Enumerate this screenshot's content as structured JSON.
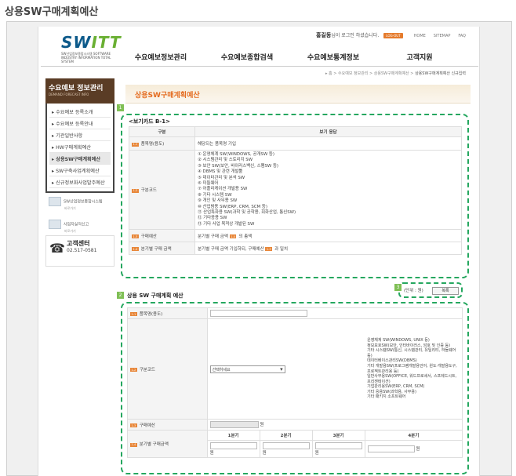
{
  "page_title": "상용SW구매계획예산",
  "header": {
    "logo_main": "SW",
    "logo_accent": "ITT",
    "logo_sub": "SW산업정보종합시스템 SOFTWARE INDUSTRY INFORMATION TOTAL SYSTEM",
    "user_name": "홍길동",
    "greeting": "님이 로그인 하셨습니다.",
    "logout": "LOG-OUT",
    "top_links": [
      "HOME",
      "SITEMAP",
      "FAQ"
    ],
    "gnb": [
      "수요예보정보관리",
      "수요예보종합검색",
      "수요예보통계정보",
      "고객지원"
    ]
  },
  "breadcrumb": {
    "path": "▸ 홈 > 수요예보 정보관리 > 상용SW구매계획예산 > ",
    "current": "상용SW구매계획예산 신규입력"
  },
  "lnb": {
    "title": "수요예보 정보관리",
    "subtitle": "DEMAND FORECAST INFO",
    "items": [
      "수요예보 등록소개",
      "수요예보 등록안내",
      "기관일반사항",
      "HW구매계획예산",
      "상용SW구매계획예산",
      "SW구축사업계획예산",
      "신규정보화사업발주예산"
    ],
    "active_index": 4,
    "links": [
      {
        "label": "SW산업정보종합시스템",
        "sub": "바로가기"
      },
      {
        "label": "사업자실적신고",
        "sub": "바로가기"
      }
    ],
    "call": {
      "label": "고객센터",
      "number": "02.517-0581"
    }
  },
  "content": {
    "title": "상용SW구매계획예산",
    "section1": {
      "badge": "1",
      "caption": "<보기카드 B-1>",
      "headers": [
        "구분",
        "보기 응답"
      ],
      "rows": [
        {
          "tag": "1-1",
          "label": "품목명(용도)",
          "value": "해당되는 품목명 기입"
        },
        {
          "tag": "1-2",
          "label": "구분코드",
          "options": [
            "① 운영체계 SW(WINDOWS, 공개SW 등)",
            "② 시스템관리 및 스토리지 SW",
            "③ 보안 SW(보안, 바이러스백신, 스팸SW 등)",
            "④ DBMS 및 관련 개발툴",
            "⑤ 데이터관리 및 분석 SW",
            "⑥ 미들웨어",
            "⑦ 어플리케이션 개발용 SW",
            "⑧ 기타 시스템 SW",
            "⑨ 개인 및 사무용 SW",
            "⑩ 산업범용 SW(ERP, CRM, SCM 등)",
            "⑪ 산업특화용 SW(과학 및 공학용, 회화산업, 통신SW)",
            "⑫ 기타응용 SW",
            "⑬ 기타 사업 목적상 개발된 SW"
          ]
        },
        {
          "tag": "1-3",
          "label": "구매예산",
          "value_pre": "분기별 구매 금액",
          "value_tag": "1-4",
          "value_post": "의 총액"
        },
        {
          "tag": "1-4",
          "label": "분기별 구매 금액",
          "value_pre": "분기별 구매 금액 기입하되, 구매예산",
          "value_tag": "1-3",
          "value_post": "과 일치"
        }
      ]
    },
    "section3": {
      "badge": "3",
      "unit": "(단위 : 원)",
      "print": "복록"
    },
    "section2": {
      "badge": "2",
      "title": "상용 SW 구매계획 예산",
      "rows": {
        "item": {
          "tag": "1-1",
          "label": "품목명(용도)"
        },
        "code": {
          "tag": "1-2",
          "label": "구분코드",
          "select_text": "선택하세요",
          "options": [
            "운영체계 SW(WINDOWS, UNIX 등)",
            "정보보호SW(보안, 인터바이러스, 암호 및 인증 등)",
            "기타 시스템SW(통신, 시스템관리, 유틸리티, 하들웨어 등)",
            "데이터베이스관리SW(DBMS)",
            "기타 개발용SW(프로그램개발용언어, 윈도·개발용도구, 프로젝트관리용 등)",
            "일반사무용SW(OFFICE, 워드프로세서, 스프레드시트, 프리젠테이션)",
            "기업관리용SW(ERP, CRM, SCM)",
            "기타 응용SW(과학용, 사무용)",
            "기타 패키지 소프트웨어"
          ]
        },
        "budget": {
          "tag": "1-3",
          "label": "구매예산",
          "unit": "원"
        },
        "quarter": {
          "tag": "1-4",
          "label": "분기별 구매금액",
          "headers": [
            "1분기",
            "2분기",
            "3분기",
            "4분기"
          ],
          "unit": "원"
        }
      }
    }
  }
}
